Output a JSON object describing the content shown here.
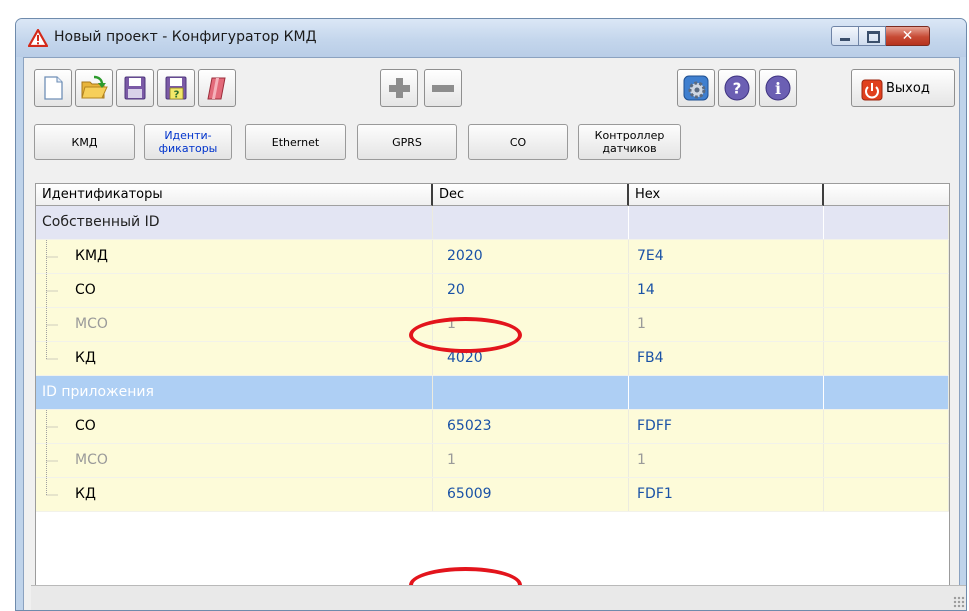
{
  "window": {
    "title": "Новый проект - Конфигуратор КМД"
  },
  "toolbar": {
    "buttons": [
      "new-file",
      "open-folder",
      "save",
      "save-as",
      "erase",
      "add",
      "remove",
      "settings",
      "help",
      "info"
    ],
    "exit_label": "Выход"
  },
  "tabs": [
    {
      "label": "КМД"
    },
    {
      "label": "Иденти-\nфикаторы"
    },
    {
      "label": "Ethernet"
    },
    {
      "label": "GPRS"
    },
    {
      "label": "CO"
    },
    {
      "label": "Контроллер\nдатчиков"
    }
  ],
  "grid": {
    "columns": [
      "Идентификаторы",
      "Dec",
      "Hex"
    ],
    "groups": [
      {
        "name": "Собственный ID",
        "rows": [
          {
            "label": "КМД",
            "dec": "2020",
            "hex": "7E4",
            "enabled": true
          },
          {
            "label": "CO",
            "dec": "20",
            "hex": "14",
            "enabled": true
          },
          {
            "label": "МСО",
            "dec": "1",
            "hex": "1",
            "enabled": false
          },
          {
            "label": "КД",
            "dec": "4020",
            "hex": "FB4",
            "enabled": true
          }
        ]
      },
      {
        "name": "ID приложения",
        "rows": [
          {
            "label": "CO",
            "dec": "65023",
            "hex": "FDFF",
            "enabled": true
          },
          {
            "label": "МСО",
            "dec": "1",
            "hex": "1",
            "enabled": false
          },
          {
            "label": "КД",
            "dec": "65009",
            "hex": "FDF1",
            "enabled": true
          }
        ]
      }
    ]
  },
  "colors": {
    "row_group_own": "#e3e5f3",
    "row_group_app": "#aecff4",
    "row_item": "#fdfbd9",
    "value_text": "#1a52a6",
    "annotation": "#e3141c"
  }
}
